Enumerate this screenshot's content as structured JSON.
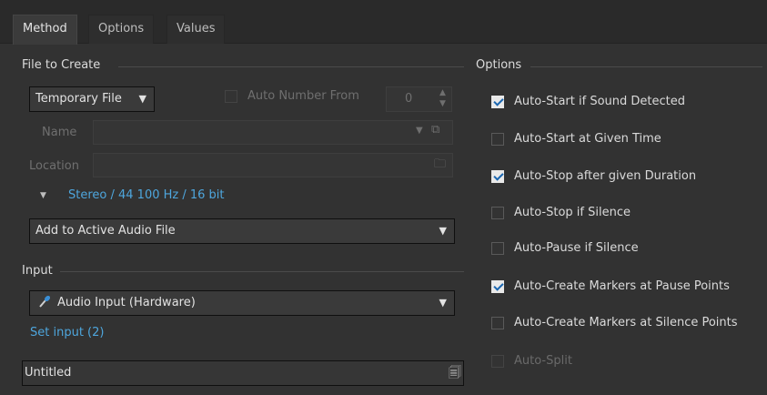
{
  "tabs": [
    {
      "label": "Method",
      "active": true
    },
    {
      "label": "Options",
      "active": false
    },
    {
      "label": "Values",
      "active": false
    }
  ],
  "file_to_create": {
    "title": "File to Create",
    "file_type": "Temporary File",
    "auto_number_label": "Auto Number From",
    "auto_number_value": "0",
    "name_label": "Name",
    "name_value": "",
    "location_label": "Location",
    "location_value": "",
    "format_link": "Stereo / 44 100 Hz / 16 bit",
    "target": "Add to Active Audio File"
  },
  "input": {
    "title": "Input",
    "device": "Audio Input (Hardware)",
    "set_input_link": "Set input (2)"
  },
  "bottom_field": {
    "value": "Untitled"
  },
  "options": {
    "title": "Options",
    "items": [
      {
        "label": "Auto-Start if Sound Detected",
        "checked": true,
        "enabled": true
      },
      {
        "label": "Auto-Start at Given Time",
        "checked": false,
        "enabled": true
      },
      {
        "label": "Auto-Stop after given Duration",
        "checked": true,
        "enabled": true
      },
      {
        "label": "Auto-Stop if Silence",
        "checked": false,
        "enabled": true
      },
      {
        "label": "Auto-Pause if Silence",
        "checked": false,
        "enabled": true
      },
      {
        "label": "Auto-Create Markers at Pause Points",
        "checked": true,
        "enabled": true
      },
      {
        "label": "Auto-Create Markers at Silence Points",
        "checked": false,
        "enabled": true
      },
      {
        "label": "Auto-Split",
        "checked": false,
        "enabled": false
      }
    ]
  },
  "colors": {
    "background": "#323232",
    "link": "#4ea6dd",
    "check_mark": "#1a66b0"
  }
}
